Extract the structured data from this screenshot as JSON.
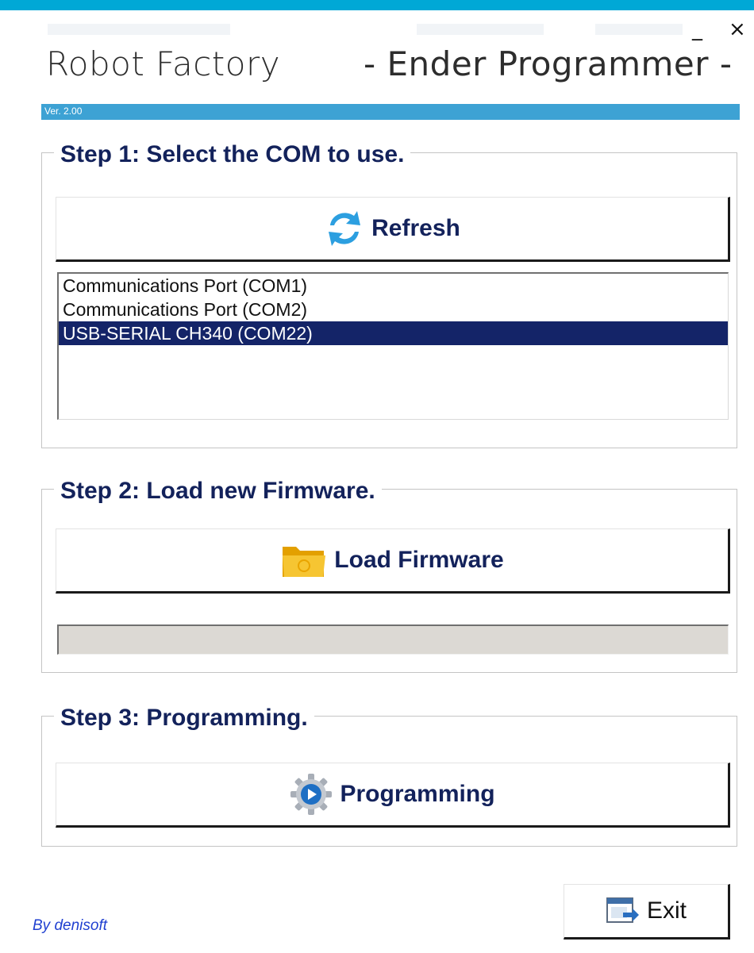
{
  "window": {
    "minimize_label": "_",
    "close_label": "×"
  },
  "header": {
    "title_left": "Robot Factory",
    "title_right": "- Ender Programmer -",
    "version": "Ver. 2.00"
  },
  "step1": {
    "legend": "Step 1:  Select the COM to use.",
    "refresh_label": "Refresh",
    "refresh_icon": "refresh-icon",
    "ports": [
      {
        "label": "Communications Port (COM1)",
        "selected": false
      },
      {
        "label": "Communications Port (COM2)",
        "selected": false
      },
      {
        "label": "USB-SERIAL CH340 (COM22)",
        "selected": true
      }
    ]
  },
  "step2": {
    "legend": "Step 2: Load new Firmware.",
    "load_label": "Load Firmware",
    "load_icon": "folder-icon",
    "progress": 0
  },
  "step3": {
    "legend": "Step 3: Programming.",
    "program_label": "Programming",
    "program_icon": "gear-play-icon"
  },
  "footer": {
    "exit_label": "Exit",
    "exit_icon": "exit-icon",
    "credit": "By denisoft"
  },
  "colors": {
    "accent_bar": "#00a8d6",
    "version_bar": "#3da2d4",
    "selection": "#142468",
    "legend_text": "#13225b",
    "credit_text": "#1f3fd0"
  }
}
